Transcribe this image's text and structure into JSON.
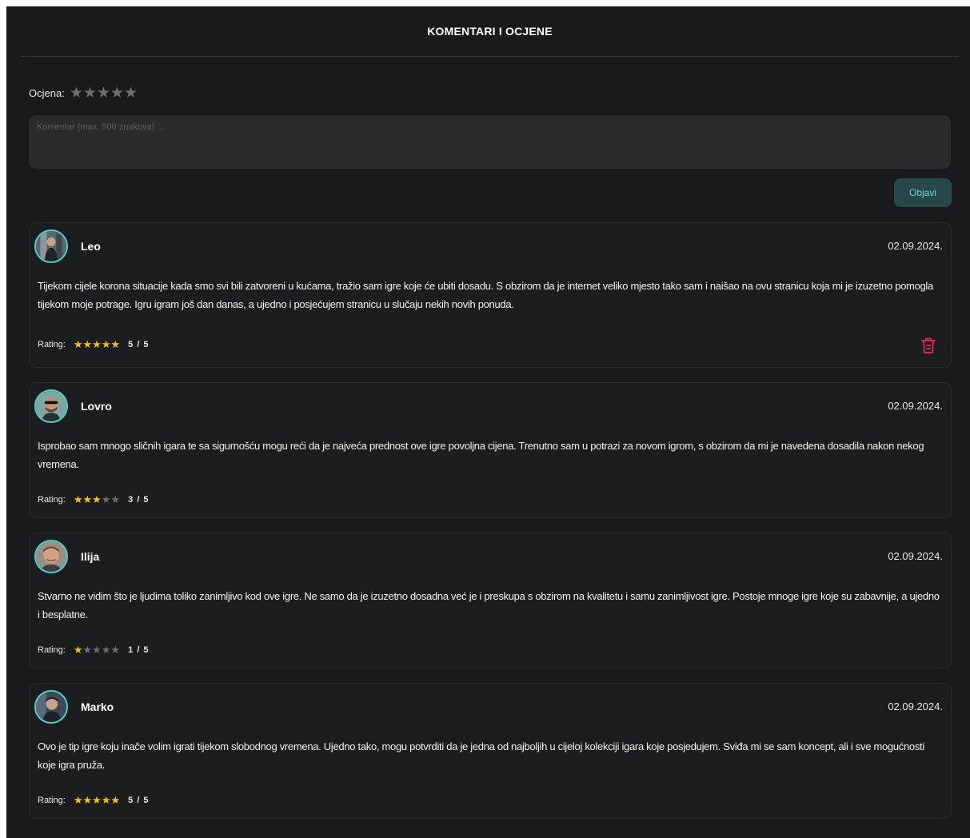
{
  "header": {
    "title": "KOMENTARI I OCJENE"
  },
  "form": {
    "rating_label": "Ocjena:",
    "rating_stars": "★★★★★",
    "comment_placeholder": "Komentar (max. 500 znakova) ...",
    "submit_label": "Objavi"
  },
  "colors": {
    "accent": "#4fd1c9",
    "star_on": "#f5c400",
    "star_off": "#6c6e71",
    "delete": "#e8285a",
    "background": "#191a1b"
  },
  "comments": [
    {
      "name": "Leo",
      "date": "02.09.2024.",
      "text": "Tijekom cijele korona situacije kada smo svi bili zatvoreni u kućama, tražio sam igre koje će ubiti dosadu. S obzirom da je internet veliko mjesto tako sam i naišao na ovu stranicu koja mi je izuzetno pomogla tijekom moje potrage. Igru igram još dan danas, a ujedno i posjećujem stranicu u slučaju nekih novih ponuda.",
      "rating_label": "Rating:",
      "stars_on": "★★★★★",
      "stars_off": "",
      "rating": 5,
      "score": "5 / 5",
      "deletable": true,
      "avatar_icon": "user-avatar-icon"
    },
    {
      "name": "Lovro",
      "date": "02.09.2024.",
      "text": "Isprobao sam mnogo sličnih igara te sa sigurnošću mogu reći da je najveća prednost ove igre povoljna cijena. Trenutno sam u potrazi za novom igrom, s obzirom da mi je navedena dosadila nakon nekog vremena.",
      "rating_label": "Rating:",
      "stars_on": "★★★",
      "stars_off": "★★",
      "rating": 3,
      "score": "3 / 5",
      "deletable": false,
      "avatar_icon": "user-avatar-icon"
    },
    {
      "name": "Ilija",
      "date": "02.09.2024.",
      "text": "Stvarno ne vidim što je ljudima toliko zanimljivo kod ove igre. Ne samo da je izuzetno dosadna već je i preskupa s obzirom na kvalitetu i samu zanimljivost igre. Postoje mnoge igre koje su zabavnije, a ujedno i besplatne.",
      "rating_label": "Rating:",
      "stars_on": "★",
      "stars_off": "★★★★",
      "rating": 1,
      "score": "1 / 5",
      "deletable": false,
      "avatar_icon": "user-avatar-icon"
    },
    {
      "name": "Marko",
      "date": "02.09.2024.",
      "text": "Ovo je tip igre koju inače volim igrati tijekom slobodnog vremena. Ujedno tako, mogu potvrditi da je jedna od najboljih u cijeloj kolekciji igara koje posjedujem. Sviđa mi se sam koncept, ali i sve mogućnosti koje igra pruža.",
      "rating_label": "Rating:",
      "stars_on": "★★★★★",
      "stars_off": "",
      "rating": 5,
      "score": "5 / 5",
      "deletable": false,
      "avatar_icon": "user-avatar-icon"
    }
  ]
}
